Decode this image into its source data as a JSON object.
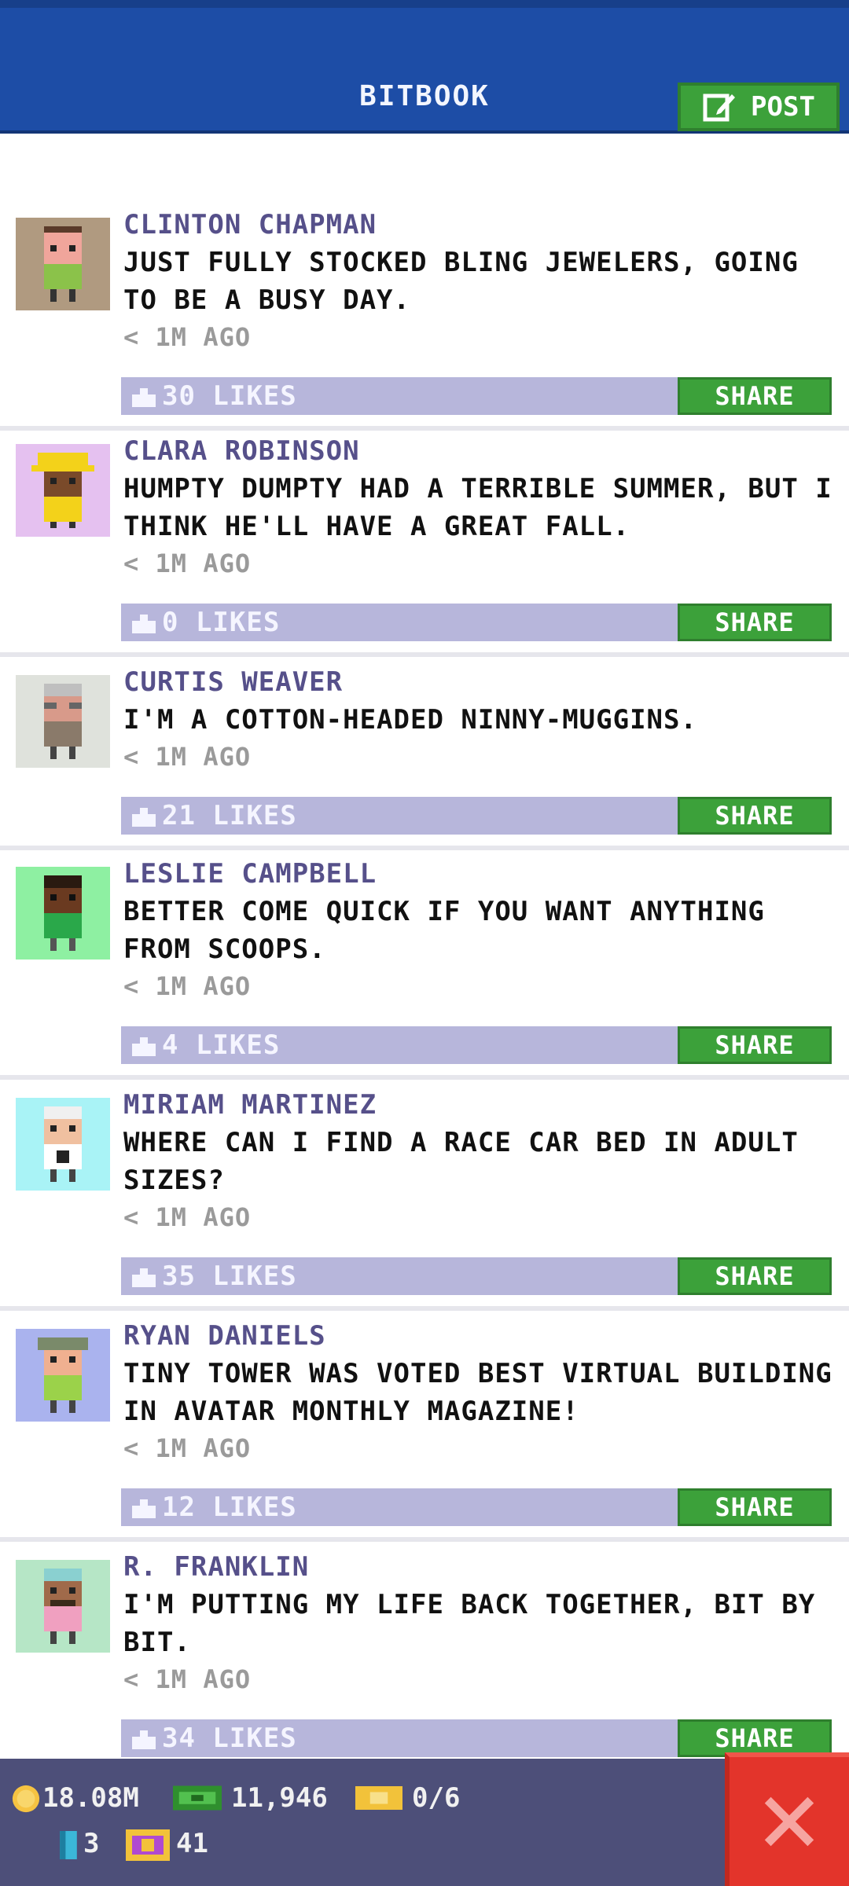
{
  "header": {
    "title": "BITBOOK",
    "post_label": "POST"
  },
  "posts": [
    {
      "name": "CLINTON CHAPMAN",
      "text": "JUST FULLY STOCKED BLING JEWELERS, GOING TO BE A BUSY DAY.",
      "time": "< 1M AGO",
      "likes": "30 LIKES",
      "share": "SHARE",
      "avatar_bg": "#b09a80"
    },
    {
      "name": "CLARA ROBINSON",
      "text": "HUMPTY DUMPTY HAD A TERRIBLE SUMMER, BUT I THINK HE'LL HAVE A GREAT FALL.",
      "time": "< 1M AGO",
      "likes": "0 LIKES",
      "share": "SHARE",
      "avatar_bg": "#e5c1f0"
    },
    {
      "name": "CURTIS WEAVER",
      "text": "I'M A COTTON-HEADED NINNY-MUGGINS.",
      "time": "< 1M AGO",
      "likes": "21 LIKES",
      "share": "SHARE",
      "avatar_bg": "#dfe2dc"
    },
    {
      "name": "LESLIE CAMPBELL",
      "text": "BETTER COME QUICK IF YOU WANT ANYTHING FROM SCOOPS.",
      "time": "< 1M AGO",
      "likes": "4 LIKES",
      "share": "SHARE",
      "avatar_bg": "#8ef0a2"
    },
    {
      "name": "MIRIAM MARTINEZ",
      "text": "WHERE CAN I FIND A RACE CAR BED IN ADULT SIZES?",
      "time": "< 1M AGO",
      "likes": "35 LIKES",
      "share": "SHARE",
      "avatar_bg": "#a9f3f6"
    },
    {
      "name": "RYAN DANIELS",
      "text": "TINY TOWER WAS VOTED BEST VIRTUAL BUILDING IN AVATAR MONTHLY MAGAZINE!",
      "time": "< 1M AGO",
      "likes": "12 LIKES",
      "share": "SHARE",
      "avatar_bg": "#aab3ee"
    },
    {
      "name": "R. FRANKLIN",
      "text": "I'M PUTTING MY LIFE BACK TOGETHER, BIT BY BIT.",
      "time": "< 1M AGO",
      "likes": "34 LIKES",
      "share": "SHARE",
      "avatar_bg": "#b6e6c6"
    }
  ],
  "footer": {
    "coins": "18.08M",
    "bux": "11,946",
    "tickets": "0/6",
    "keys": "3",
    "vip": "41"
  },
  "colors": {
    "header_bg": "#1d4da6",
    "accent_green": "#3ca13a",
    "likes_bar": "#b7b6db",
    "name_color": "#56508a",
    "footer_bg": "#4d4f79",
    "close_red": "#e3342b"
  },
  "icons": {
    "post": "edit-icon",
    "like": "thumb-up-icon",
    "coin": "coin-icon",
    "bux": "bux-icon",
    "ticket": "ticket-icon",
    "key": "key-icon",
    "vip": "vip-icon",
    "close": "close-icon"
  }
}
